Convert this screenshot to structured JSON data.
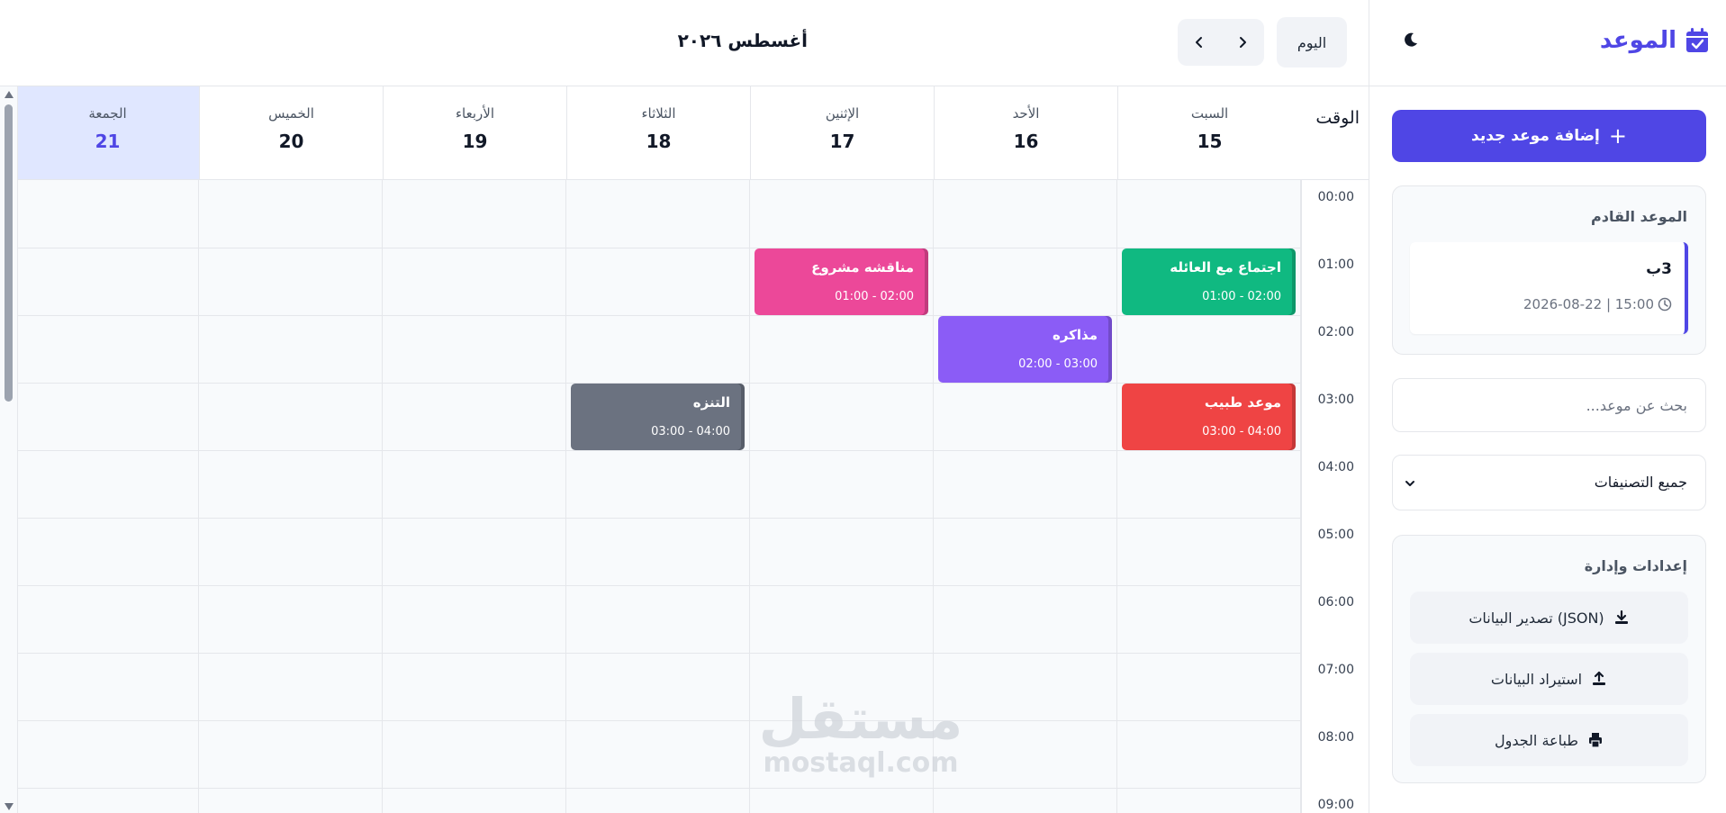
{
  "app": {
    "brand": "الموعد",
    "theme_toggle_icon": "moon-icon",
    "accent_color": "#4f46e5"
  },
  "sidebar": {
    "add_button": "إضافة موعد جديد",
    "upcoming": {
      "heading": "الموعد القادم",
      "title": "3ب",
      "date_time": "2026-08-22 | 15:00"
    },
    "search": {
      "placeholder": "بحث عن موعد..."
    },
    "category_filter": {
      "selected": "جميع التصنيفات"
    },
    "settings": {
      "heading": "إعدادات وإدارة",
      "export_label": "تصدير البيانات (JSON)",
      "import_label": "استيراد البيانات",
      "print_label": "طباعة الجدول"
    }
  },
  "toolbar": {
    "today": "اليوم",
    "month_title": "أغسطس ٢٠٢٦"
  },
  "calendar": {
    "time_header": "الوقت",
    "days": [
      {
        "name": "السبت",
        "num": "15",
        "today": false
      },
      {
        "name": "الأحد",
        "num": "16",
        "today": false
      },
      {
        "name": "الإثنين",
        "num": "17",
        "today": false
      },
      {
        "name": "الثلاثاء",
        "num": "18",
        "today": false
      },
      {
        "name": "الأربعاء",
        "num": "19",
        "today": false
      },
      {
        "name": "الخميس",
        "num": "20",
        "today": false
      },
      {
        "name": "الجمعة",
        "num": "21",
        "today": true
      }
    ],
    "times": [
      "00:00",
      "01:00",
      "02:00",
      "03:00",
      "04:00",
      "05:00",
      "06:00",
      "07:00",
      "08:00",
      "09:00"
    ],
    "events": [
      {
        "title": "اجتماع مع العائله",
        "time": "01:00 - 02:00",
        "day": 0,
        "hour": 1,
        "color": "#10b981"
      },
      {
        "title": "مناقشه مشروع",
        "time": "01:00 - 02:00",
        "day": 2,
        "hour": 1,
        "color": "#ec4899"
      },
      {
        "title": "مذاكره",
        "time": "02:00 - 03:00",
        "day": 1,
        "hour": 2,
        "color": "#8b5cf6"
      },
      {
        "title": "موعد طبيب",
        "time": "03:00 - 04:00",
        "day": 0,
        "hour": 3,
        "color": "#ef4444"
      },
      {
        "title": "التنزه",
        "time": "03:00 - 04:00",
        "day": 3,
        "hour": 3,
        "color": "#6b7280"
      }
    ]
  },
  "watermark": {
    "arabic": "مستقل",
    "latin": "mostaql.com"
  }
}
